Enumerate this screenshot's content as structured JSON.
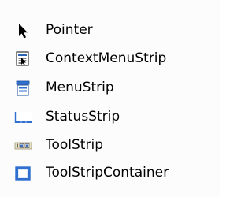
{
  "toolbox": {
    "items": [
      {
        "label": "Pointer",
        "icon": "pointer-arrow-icon"
      },
      {
        "label": "ContextMenuStrip",
        "icon": "context-menu-strip-icon"
      },
      {
        "label": "MenuStrip",
        "icon": "menu-strip-icon"
      },
      {
        "label": "StatusStrip",
        "icon": "status-strip-icon"
      },
      {
        "label": "ToolStrip",
        "icon": "tool-strip-icon"
      },
      {
        "label": "ToolStripContainer",
        "icon": "tool-strip-container-icon"
      }
    ]
  },
  "colors": {
    "background": "#fcfcfc",
    "icon_blue": "#1f5fb8",
    "icon_dark": "#1a1a1a"
  }
}
